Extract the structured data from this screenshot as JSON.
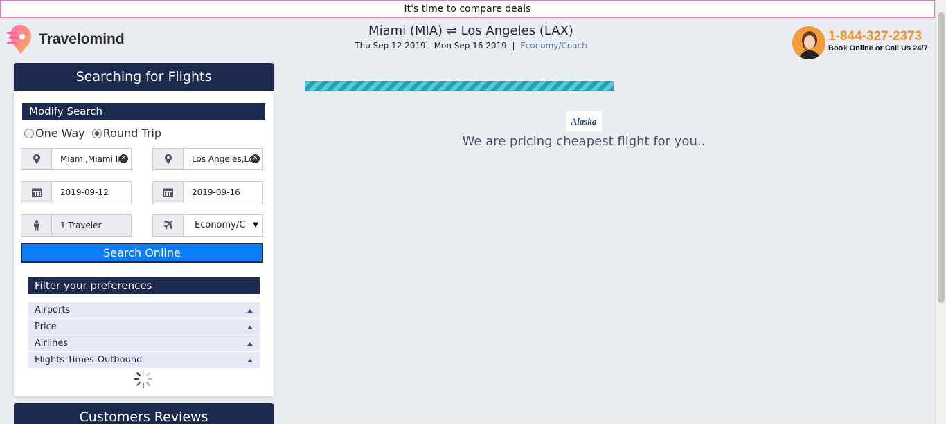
{
  "promo": {
    "text": "It's time to compare deals"
  },
  "brand": {
    "name": "Travelomind"
  },
  "trip": {
    "route": "Miami (MIA) ⇌ Los Angeles (LAX)",
    "dates": "Thu Sep 12 2019 - Mon Sep 16 2019",
    "separator": "|",
    "cabin": "Economy/Coach"
  },
  "contact": {
    "phone": "1-844-327-2373",
    "note": "Book Online or Call Us 24/7"
  },
  "sidebar": {
    "title": "Searching for Flights",
    "modify_title": "Modify Search",
    "trip_types": [
      {
        "label": "One Way",
        "checked": false
      },
      {
        "label": "Round Trip",
        "checked": true
      }
    ],
    "from": "Miami,Miami In",
    "to": "Los Angeles,Lo",
    "depart": "2019-09-12",
    "return": "2019-09-16",
    "travelers": "1  Traveler",
    "cabin_select": "Economy/C",
    "search_button": "Search Online",
    "filter_title": "Filter your preferences",
    "filters": [
      "Airports",
      "Price",
      "Airlines",
      "Flights Times-Outbound"
    ],
    "reviews_title": "Customers Reviews"
  },
  "main": {
    "progress": 1.0,
    "airline": "Alaska",
    "message": "We are pricing cheapest flight for you.."
  },
  "colors": {
    "navy": "#1c2a4f",
    "accent": "#0a7cff",
    "phone": "#f0922a",
    "progress": "#1fa3b6"
  }
}
